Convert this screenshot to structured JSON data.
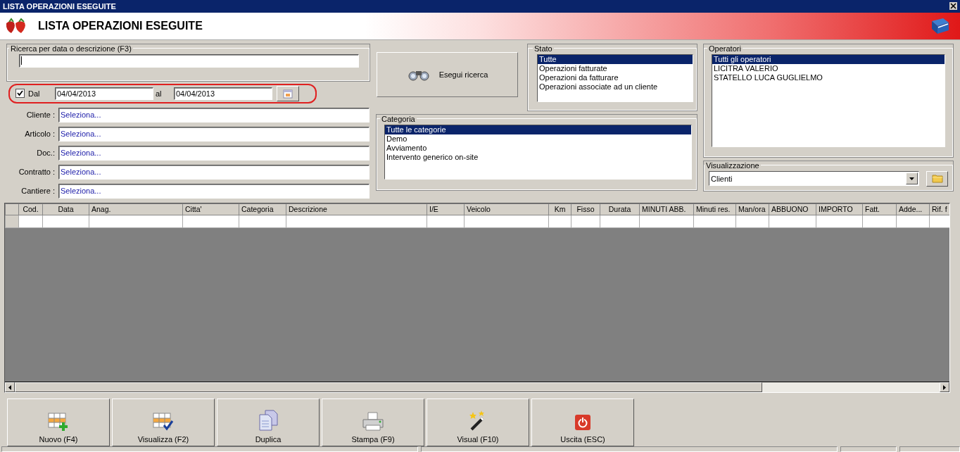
{
  "window": {
    "title": "LISTA OPERAZIONI ESEGUITE"
  },
  "header": {
    "title": "LISTA OPERAZIONI ESEGUITE"
  },
  "search": {
    "legend": "Ricerca per data o descrizione (F3)"
  },
  "date_filter": {
    "checked": true,
    "from_label": "Dal",
    "from": "04/04/2013",
    "to_label": "al",
    "to": "04/04/2013"
  },
  "fields": [
    {
      "label": "Cliente :",
      "value": "Seleziona..."
    },
    {
      "label": "Articolo :",
      "value": "Seleziona..."
    },
    {
      "label": "Doc.:",
      "value": "Seleziona..."
    },
    {
      "label": "Contratto :",
      "value": "Seleziona..."
    },
    {
      "label": "Cantiere :",
      "value": "Seleziona..."
    }
  ],
  "search_button": {
    "label": "Esegui ricerca"
  },
  "stato": {
    "title": "Stato",
    "items": [
      {
        "label": "Tutte",
        "selected": true
      },
      {
        "label": "Operazioni fatturate",
        "selected": false
      },
      {
        "label": "Operazioni da fatturare",
        "selected": false
      },
      {
        "label": "Operazioni associate ad un cliente",
        "selected": false
      }
    ]
  },
  "categoria": {
    "title": "Categoria",
    "items": [
      {
        "label": "Tutte le categorie",
        "selected": true
      },
      {
        "label": "Demo",
        "selected": false
      },
      {
        "label": "Avviamento",
        "selected": false
      },
      {
        "label": "Intervento generico on-site",
        "selected": false
      }
    ]
  },
  "operatori": {
    "title": "Operatori",
    "items": [
      {
        "label": "Tutti gli operatori",
        "selected": true
      },
      {
        "label": "LICITRA VALERIO",
        "selected": false
      },
      {
        "label": "STATELLO LUCA GUGLIELMO",
        "selected": false
      }
    ]
  },
  "visualizzazione": {
    "title": "Visualizzazione",
    "value": "Clienti"
  },
  "table": {
    "columns": [
      "Cod.",
      "Data",
      "Anag.",
      "Citta'",
      "Categoria",
      "Descrizione",
      "I/E",
      "Veicolo",
      "Km",
      "Fisso",
      "Durata",
      "MINUTI ABB.",
      "Minuti res.",
      "Man/ora",
      "ABBUONO",
      "IMPORTO",
      "Fatt.",
      "Adde...",
      "Rif. f"
    ]
  },
  "buttons": [
    {
      "label": "Nuovo (F4)",
      "kind": "new"
    },
    {
      "label": "Visualizza (F2)",
      "kind": "view"
    },
    {
      "label": "Duplica",
      "kind": "duplicate"
    },
    {
      "label": "Stampa (F9)",
      "kind": "print"
    },
    {
      "label": "Visual (F10)",
      "kind": "wand"
    },
    {
      "label": "Uscita (ESC)",
      "kind": "exit"
    }
  ]
}
